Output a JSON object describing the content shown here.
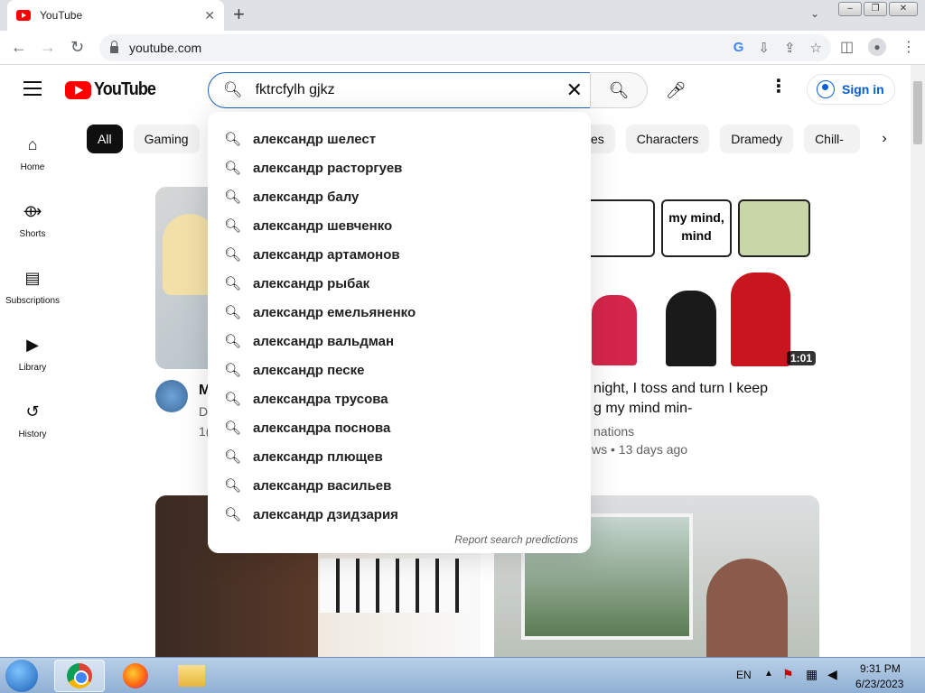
{
  "browser": {
    "tab_title": "YouTube",
    "url": "youtube.com"
  },
  "header": {
    "logo_text": "YouTube",
    "search_value": "fktrcfylh gjkz",
    "signin_label": "Sign in"
  },
  "sidebar": {
    "items": [
      {
        "label": "Home",
        "icon": "home-icon"
      },
      {
        "label": "Shorts",
        "icon": "shorts-icon"
      },
      {
        "label": "Subscriptions",
        "icon": "subscriptions-icon"
      },
      {
        "label": "Library",
        "icon": "library-icon"
      },
      {
        "label": "History",
        "icon": "history-icon"
      }
    ]
  },
  "chips": {
    "left": [
      "All",
      "Gaming"
    ],
    "right": [
      "es",
      "Characters",
      "Dramedy",
      "Chill-o"
    ]
  },
  "suggestions": [
    "александр шелест",
    "александр расторгуев",
    "александр балу",
    "александр шевченко",
    "александр артамонов",
    "александр рыбак",
    "александр емельяненко",
    "александр вальдман",
    "александр песке",
    "александра трусова",
    "александра поснова",
    "александр плющев",
    "александр васильев",
    "александр дзидзария"
  ],
  "report_label": "Report search predictions",
  "videos": [
    {
      "title_partial": "M",
      "meta1": "D",
      "meta2": "1("
    },
    {
      "title_line1": "night, I toss and turn I keep",
      "title_line2": "g my mind min-",
      "channel": "nations",
      "meta": "ws • 13 days ago",
      "duration": "1:01",
      "bubble_text": "my mind, mind"
    }
  ],
  "taskbar": {
    "lang": "EN",
    "time": "9:31 PM",
    "date": "6/23/2023"
  }
}
